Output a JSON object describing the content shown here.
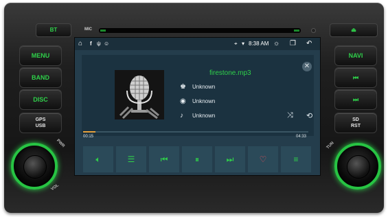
{
  "head_unit": {
    "bt_label": "BT",
    "mic_label": "MIC",
    "eject_icon": "eject-icon",
    "left_buttons": [
      "MENU",
      "BAND",
      "DISC"
    ],
    "gps_line1": "GPS",
    "gps_line2": "USB",
    "right_buttons": [
      "NAVI"
    ],
    "sd_line1": "SD",
    "sd_line2": "RST",
    "pwr_label": "PWR",
    "vol_label": "VOL",
    "tun_label": "TUN",
    "accent_color": "#2fd04a"
  },
  "status_bar": {
    "left_icons": [
      "home-icon",
      "facebook-icon",
      "usb-icon",
      "android-icon"
    ],
    "time": "8:38 AM",
    "right_icons": [
      "location-icon",
      "wifi-icon",
      "brightness-icon",
      "recent-apps-icon",
      "back-icon"
    ]
  },
  "player": {
    "file_name": "firestone.mp3",
    "artist": "Unknown",
    "album": "Unknown",
    "genre": "Unknown",
    "elapsed": "00:15",
    "duration": "04:33",
    "progress_fraction": 0.055,
    "controls": [
      "volume-icon",
      "equalizer-icon",
      "previous-icon",
      "pause-icon",
      "next-icon",
      "favorite-icon",
      "playlist-icon"
    ]
  }
}
